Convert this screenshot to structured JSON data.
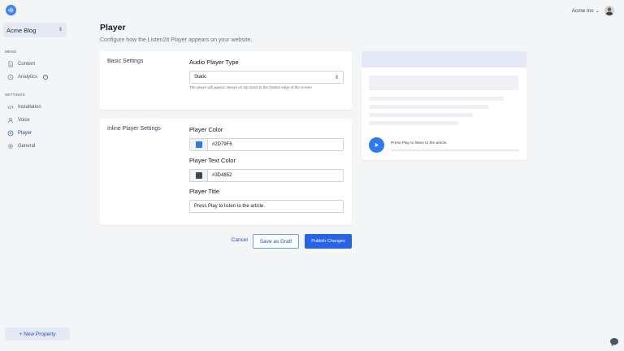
{
  "sidebar": {
    "property_name": "Acme Blog",
    "menu_label": "MENU",
    "menu_items": [
      {
        "label": "Content",
        "icon": "document-icon"
      },
      {
        "label": "Analytics",
        "icon": "clock-icon",
        "badge": "+"
      }
    ],
    "settings_label": "SETTINGS",
    "settings_items": [
      {
        "label": "Installation",
        "icon": "code-icon"
      },
      {
        "label": "Voice",
        "icon": "user-icon"
      },
      {
        "label": "Player",
        "icon": "play-circle-icon",
        "active": true
      },
      {
        "label": "General",
        "icon": "gear-icon"
      }
    ],
    "new_property_label": "+ New Property"
  },
  "header": {
    "account_name": "Acme Inc",
    "account_caret": "⌄"
  },
  "page": {
    "title": "Player",
    "subtitle": "Configure how the Listen2It Player appears on your website."
  },
  "basic_settings": {
    "section_label": "Basic Settings",
    "audio_player_type_label": "Audio Player Type",
    "audio_player_type_value": "Static",
    "audio_player_type_help": "The player will appear always on top stuck to the bottom edge of the screen."
  },
  "inline_settings": {
    "section_label": "Inline Player Settings",
    "player_color_label": "Player Color",
    "player_color_value": "#2D79F6",
    "player_text_color_label": "Player Text Color",
    "player_text_color_value": "#3D4852",
    "player_title_label": "Player Title",
    "player_title_value": "Press Play to listen to the article."
  },
  "actions": {
    "cancel_label": "Cancel",
    "draft_label": "Save as Draft",
    "publish_label": "Publish Changes"
  },
  "preview": {
    "player_title": "Press Play to listen to the article."
  },
  "colors": {
    "accent": "#2563eb",
    "player_color": "#2D79F6",
    "player_text_color": "#3D4852"
  }
}
